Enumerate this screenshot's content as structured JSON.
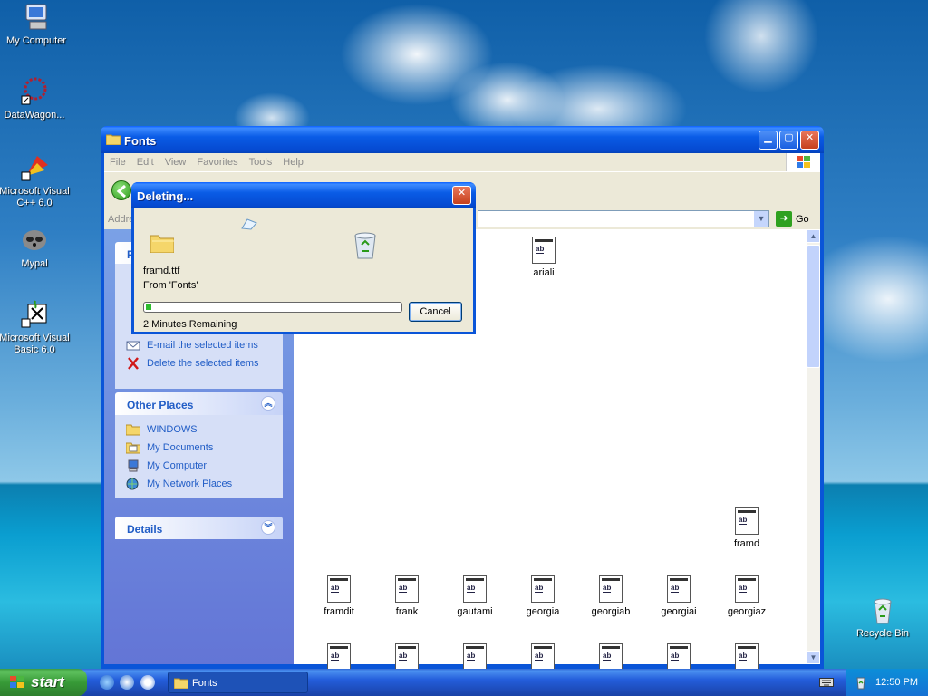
{
  "desktop": {
    "icons": [
      {
        "label": "My Computer"
      },
      {
        "label": "DataWagon..."
      },
      {
        "label": "Microsoft Visual C++ 6.0"
      },
      {
        "label": "Mypal"
      },
      {
        "label": "Microsoft Visual Basic 6.0"
      },
      {
        "label": "Recycle Bin"
      }
    ]
  },
  "window": {
    "title": "Fonts",
    "menu": [
      "File",
      "Edit",
      "View",
      "Favorites",
      "Tools",
      "Help"
    ],
    "address_label": "Addre",
    "go_label": "Go"
  },
  "taskpane": {
    "tasks_partial_title": "F",
    "tasks": [
      "E-mail the selected items",
      "Delete the selected items"
    ],
    "other_places": {
      "title": "Other Places",
      "items": [
        "WINDOWS",
        "My Documents",
        "My Computer",
        "My Network Places"
      ]
    },
    "details": {
      "title": "Details"
    }
  },
  "files": [
    "ariali",
    "framd",
    "framdit",
    "frank",
    "gautami",
    "georgia",
    "georgiab",
    "georgiai",
    "georgiaz"
  ],
  "dialog": {
    "title": "Deleting...",
    "filename": "framd.ttf",
    "from": "From 'Fonts'",
    "remaining": "2 Minutes Remaining",
    "progress": 0.02,
    "cancel_label": "Cancel"
  },
  "taskbar": {
    "start_label": "start",
    "task_label": "Fonts",
    "clock": "12:50 PM"
  },
  "colors": {
    "xp_blue": "#0a55d8",
    "link_blue": "#215dc6",
    "progress_green": "#2fbd2f"
  }
}
